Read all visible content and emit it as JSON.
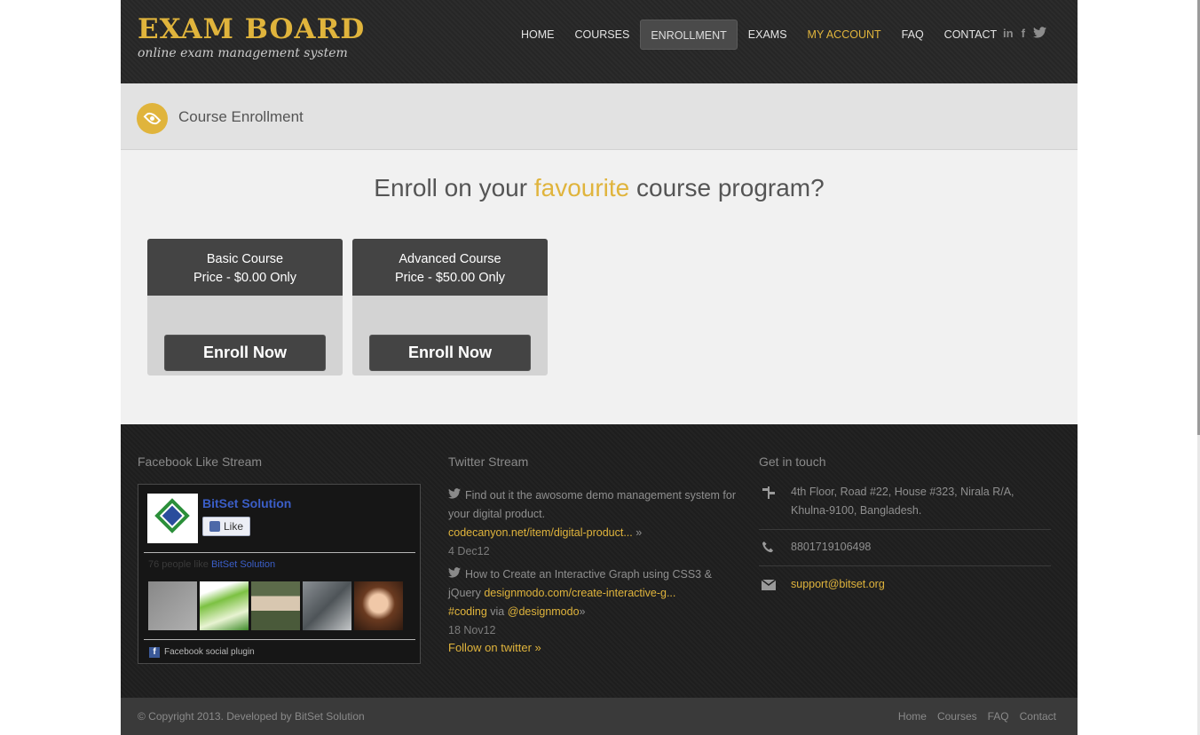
{
  "header": {
    "logo_title": "EXAM BOARD",
    "logo_subtitle": "online exam management system",
    "nav": [
      "HOME",
      "COURSES",
      "ENROLLMENT",
      "EXAMS",
      "MY ACCOUNT",
      "FAQ",
      "CONTACT"
    ],
    "active_nav": "ENROLLMENT",
    "social_icons": [
      "linkedin-icon",
      "facebook-icon",
      "twitter-icon"
    ]
  },
  "titlebar": {
    "icon": "eye-icon",
    "title": "Course Enrollment"
  },
  "main": {
    "headline_pre": "Enroll on your ",
    "headline_highlight": "favourite",
    "headline_post": " course program?",
    "courses": [
      {
        "name": "Basic Course",
        "price": "Price - $0.00 Only",
        "button": "Enroll Now"
      },
      {
        "name": "Advanced Course",
        "price": "Price - $50.00 Only",
        "button": "Enroll Now"
      }
    ]
  },
  "footer": {
    "facebook": {
      "title": "Facebook Like Stream",
      "page_name": "BitSet Solution",
      "like_label": "Like",
      "count_text": "76 people like ",
      "count_link": "BitSet Solution",
      "plugin_label": "Facebook social plugin"
    },
    "twitter": {
      "title": "Twitter Stream",
      "tweets": [
        {
          "text": "Find out it the awosome demo management system for your digital product.",
          "link": "codecanyon.net/item/digital-product...",
          "date": "4 Dec12"
        },
        {
          "text": "How to Create an Interactive Graph using CSS3 & jQuery",
          "link": "designmodo.com/create-interactive-g...",
          "hashtag": "#coding",
          "via": "via",
          "handle": "@designmodo",
          "date": "18 Nov12"
        }
      ],
      "follow": "Follow on twitter »"
    },
    "contact": {
      "title": "Get in touch",
      "address": "4th Floor, Road #22, House #323, Nirala R/A, Khulna-9100, Bangladesh.",
      "phone": "8801719106498",
      "email": "support@bitset.org"
    },
    "copyright": "© Copyright 2013. Developed by BitSet Solution",
    "links": [
      "Home",
      "Courses",
      "FAQ",
      "Contact"
    ]
  },
  "colors": {
    "accent": "#e0b43c",
    "header_bg": "#2a2a2a",
    "footer_bg": "#202020",
    "card_head": "#444444"
  }
}
